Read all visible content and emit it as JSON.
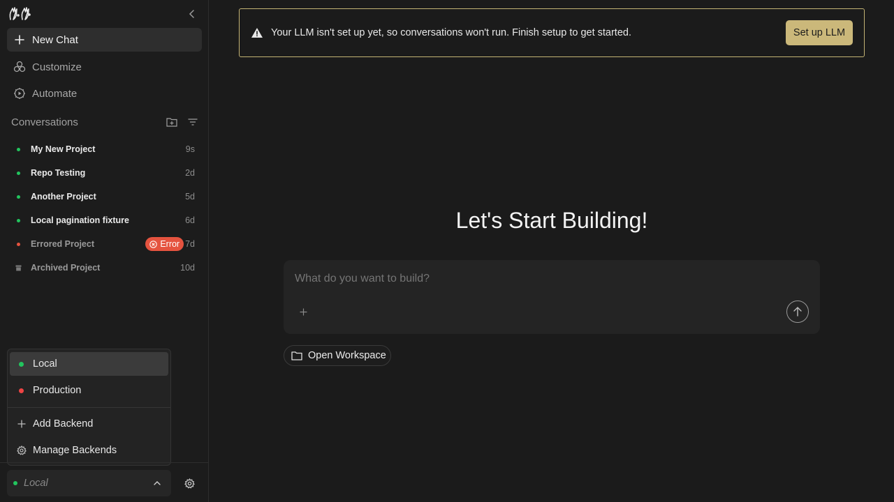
{
  "sidebar": {
    "nav": {
      "new_chat": "New Chat",
      "customize": "Customize",
      "automate": "Automate"
    },
    "conversations": {
      "title": "Conversations",
      "items": [
        {
          "name": "My New Project",
          "time": "9s",
          "status": "active"
        },
        {
          "name": "Repo Testing",
          "time": "2d",
          "status": "active"
        },
        {
          "name": "Another Project",
          "time": "5d",
          "status": "active"
        },
        {
          "name": "Local pagination fixture",
          "time": "6d",
          "status": "active"
        },
        {
          "name": "Errored Project",
          "time": "7d",
          "status": "error",
          "badge": "Error"
        },
        {
          "name": "Archived Project",
          "time": "10d",
          "status": "archived"
        }
      ]
    },
    "backend_menu": {
      "items": [
        {
          "label": "Local",
          "status_color": "#22c55e"
        },
        {
          "label": "Production",
          "status_color": "#ef4444"
        }
      ],
      "add_backend": "Add Backend",
      "manage_backends": "Manage Backends"
    },
    "backend_select": {
      "label": "Local",
      "status_color": "#22c55e"
    }
  },
  "banner": {
    "message": "Your LLM isn't set up yet, so conversations won't run. Finish setup to get started.",
    "button": "Set up LLM"
  },
  "main": {
    "headline": "Let's Start Building!",
    "prompt_placeholder": "What do you want to build?",
    "open_workspace": "Open Workspace"
  },
  "colors": {
    "active_dot": "#22c55e",
    "error_dot": "#e5533f",
    "accent": "#cbb87a"
  }
}
